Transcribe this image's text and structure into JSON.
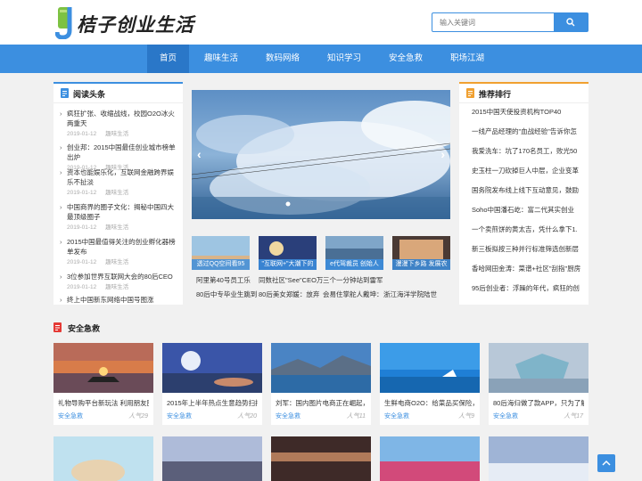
{
  "site": {
    "logo_text": "桔子创业生活"
  },
  "search": {
    "placeholder": "输入关键词"
  },
  "nav": [
    "首页",
    "趣味生活",
    "数码网络",
    "知识学习",
    "安全急救",
    "职场江湖"
  ],
  "left_panel": {
    "title": "阅读头条",
    "items": [
      {
        "title": "疯狂扩张、收缩战线，校园O2O冰火两重天",
        "date": "2019-01-12",
        "cat": "趣味生活"
      },
      {
        "title": "创业邦：2015中国最佳创业城市榜单出炉",
        "date": "2019-01-12",
        "cat": "趣味生活"
      },
      {
        "title": "资本也能娱乐化，互联网金融跨界娱乐不扯淡",
        "date": "2019-01-12",
        "cat": "趣味生活"
      },
      {
        "title": "中国商界的圈子文化：揭秘中国四大最顶级圈子",
        "date": "2019-01-12",
        "cat": "趣味生活"
      },
      {
        "title": "2015中国最值得关注的创业孵化器榜单发布",
        "date": "2019-01-12",
        "cat": "趣味生活"
      },
      {
        "title": "3位参加世界互联网大会的80后CEO",
        "date": "2019-01-12",
        "cat": "趣味生活"
      },
      {
        "title": "终上中国新东网络中国号图涨"
      }
    ]
  },
  "slider_thumbs": [
    "透过QQ空间看95",
    "\"互联网+\"大潮下的",
    "e代驾裁员 创始人",
    "漫漫下乡路 发展农"
  ],
  "mid_news": [
    [
      "阿里第40号员工乐",
      "同数社区\"See\"CEO万",
      "三个一分钟站到雷军"
    ],
    [
      "80后中专毕业生跳到",
      "80后美女郑媛：放弃",
      "会易住掌舵人戴坤：",
      "浙江海洋学院陆世"
    ]
  ],
  "right_panel": {
    "title": "推荐排行",
    "items": [
      "2015中国天使投资机构TOP40",
      "一线产品经理的\"血战经验\"告诉你怎",
      "我爱洗车：坑了170名员工，败光50",
      "史玉柱一刀砍掉巨人中层，企业变革",
      "国务院发布线上线下互动意见，鼓励",
      "Soho中国潘石屹：富二代其实创业",
      "一个卖煎饼的黄太吉，凭什么拿下1.",
      "新三板拟按三种并行标准筛选创新层",
      "香哈网田金涛：菜谱+社区\"刮指\"厨房",
      "95后创业者：浮躁的年代，疯狂的创"
    ]
  },
  "section": {
    "title": "安全急救",
    "cards": [
      {
        "title": "礼物导购平台新玩法 利用朋友圈",
        "cat": "安全急救",
        "pop": "人气29"
      },
      {
        "title": "2015年上半年热点生意趋势扫描",
        "cat": "安全急救",
        "pop": "人气20"
      },
      {
        "title": "刘军：国内图片电商正在崛起，",
        "cat": "安全急救",
        "pop": "人气11"
      },
      {
        "title": "生鲜电商O2O：给菜品买保险，",
        "cat": "安全急救",
        "pop": "人气9"
      },
      {
        "title": "80后海归做了款APP，只为了解",
        "cat": "安全急救",
        "pop": "人气17"
      }
    ]
  },
  "colors": {
    "accent": "#3c8fe0",
    "red_bar": "#e53935",
    "orange_bar": "#f0a030"
  }
}
